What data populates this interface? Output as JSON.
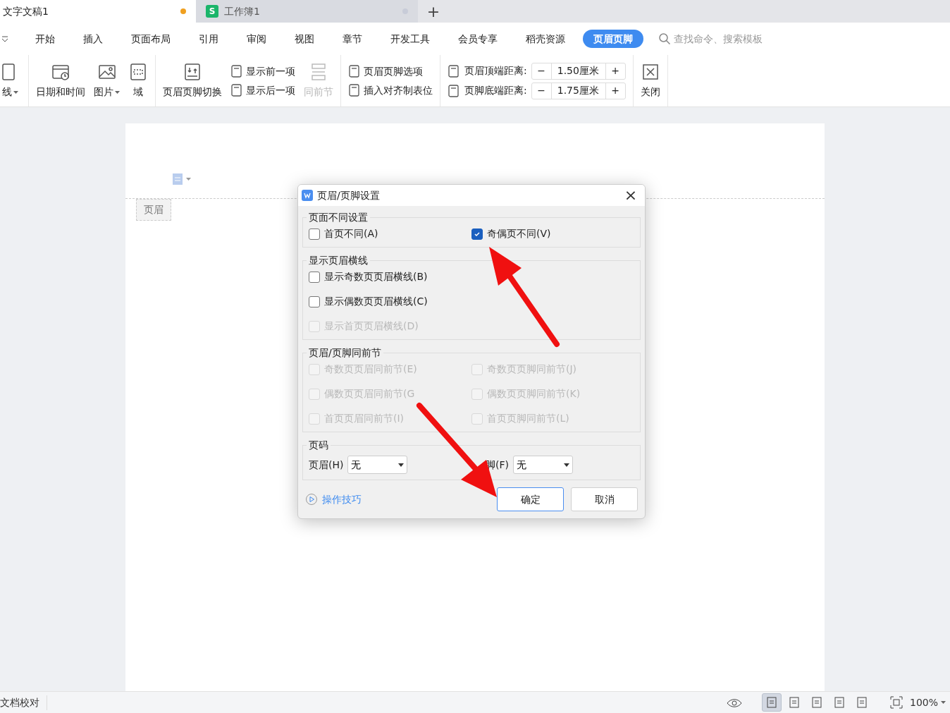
{
  "tabs": [
    {
      "label": "文字文稿1",
      "selected": true,
      "color": "#f0a020"
    },
    {
      "label": "工作簿1",
      "selected": false,
      "badge": "S",
      "color": "#c8ccd8"
    }
  ],
  "new_tab": "+",
  "menu": [
    {
      "label": "开始",
      "selected": false
    },
    {
      "label": "插入",
      "selected": false
    },
    {
      "label": "页面布局",
      "selected": false
    },
    {
      "label": "引用",
      "selected": false
    },
    {
      "label": "审阅",
      "selected": false
    },
    {
      "label": "视图",
      "selected": false
    },
    {
      "label": "章节",
      "selected": false
    },
    {
      "label": "开发工具",
      "selected": false
    },
    {
      "label": "会员专享",
      "selected": false
    },
    {
      "label": "稻壳资源",
      "selected": false
    },
    {
      "label": "页眉页脚",
      "selected": true
    }
  ],
  "search": {
    "placeholder": "查找命令、搜索模板"
  },
  "ribbon": [
    {
      "items": [
        {
          "kind": "large",
          "label": "线",
          "dropdown": true,
          "disabled": false
        }
      ]
    },
    {
      "items": [
        {
          "kind": "large",
          "label": "日期和时间",
          "dropdown": false,
          "disabled": false
        },
        {
          "kind": "large",
          "label": "图片",
          "dropdown": true,
          "disabled": false
        },
        {
          "kind": "large",
          "label": "域",
          "dropdown": false,
          "disabled": false
        }
      ]
    },
    {
      "items": [
        {
          "kind": "large",
          "label": "页眉页脚切换",
          "dropdown": false,
          "disabled": false
        },
        {
          "kind": "stack",
          "rows": [
            {
              "label": "显示前一项",
              "disabled": false
            },
            {
              "label": "显示后一项",
              "disabled": false
            }
          ]
        },
        {
          "kind": "large",
          "label": "同前节",
          "dropdown": false,
          "disabled": true
        }
      ]
    },
    {
      "items": [
        {
          "kind": "stack",
          "rows": [
            {
              "label": "页眉页脚选项",
              "disabled": false
            },
            {
              "label": "插入对齐制表位",
              "disabled": false
            }
          ]
        }
      ]
    },
    {
      "items": [
        {
          "kind": "spinners",
          "rows": [
            {
              "label": "页眉顶端距离:",
              "value": "1.50厘米",
              "minus": "−",
              "plus": "+"
            },
            {
              "label": "页脚底端距离:",
              "value": "1.75厘米",
              "minus": "−",
              "plus": "+"
            }
          ]
        }
      ]
    },
    {
      "items": [
        {
          "kind": "large",
          "label": "关闭",
          "dropdown": false,
          "disabled": false
        }
      ]
    }
  ],
  "document": {
    "header_tag": "页眉"
  },
  "dialog": {
    "title": "页眉/页脚设置",
    "close": "×",
    "sections": [
      {
        "title": "页面不同设置",
        "kind": "check-grid",
        "options": [
          {
            "label": "首页不同(A)",
            "checked": false,
            "disabled": false
          },
          {
            "label": "奇偶页不同(V)",
            "checked": true,
            "disabled": false
          }
        ]
      },
      {
        "title": "显示页眉横线",
        "kind": "check-list",
        "options": [
          {
            "label": "显示奇数页页眉横线(B)",
            "checked": false,
            "disabled": false
          },
          {
            "label": "显示偶数页页眉横线(C)",
            "checked": false,
            "disabled": false
          },
          {
            "label": "显示首页页眉横线(D)",
            "checked": false,
            "disabled": true
          }
        ]
      },
      {
        "title": "页眉/页脚同前节",
        "kind": "check-grid",
        "options": [
          {
            "label": "奇数页页眉同前节(E)",
            "checked": false,
            "disabled": true
          },
          {
            "label": "奇数页页脚同前节(J)",
            "checked": false,
            "disabled": true
          },
          {
            "label": "偶数页页眉同前节(G",
            "checked": false,
            "disabled": true
          },
          {
            "label": "偶数页页脚同前节(K)",
            "checked": false,
            "disabled": true
          },
          {
            "label": "首页页眉同前节(I)",
            "checked": false,
            "disabled": true
          },
          {
            "label": "首页页脚同前节(L)",
            "checked": false,
            "disabled": true
          }
        ]
      },
      {
        "title": "页码",
        "kind": "selects",
        "selects": [
          {
            "label": "页眉(H)",
            "value": "无"
          },
          {
            "label": "脚(F)",
            "value": "无"
          }
        ]
      }
    ],
    "help_link": "操作技巧",
    "buttons": [
      {
        "label": "确定",
        "default": true
      },
      {
        "label": "取消",
        "default": false
      }
    ]
  },
  "status_bar": {
    "proofing": "文档校对",
    "views": [
      {
        "selected": true
      },
      {
        "selected": false
      },
      {
        "selected": false
      },
      {
        "selected": false
      },
      {
        "selected": false
      }
    ],
    "zoom": "100%"
  }
}
